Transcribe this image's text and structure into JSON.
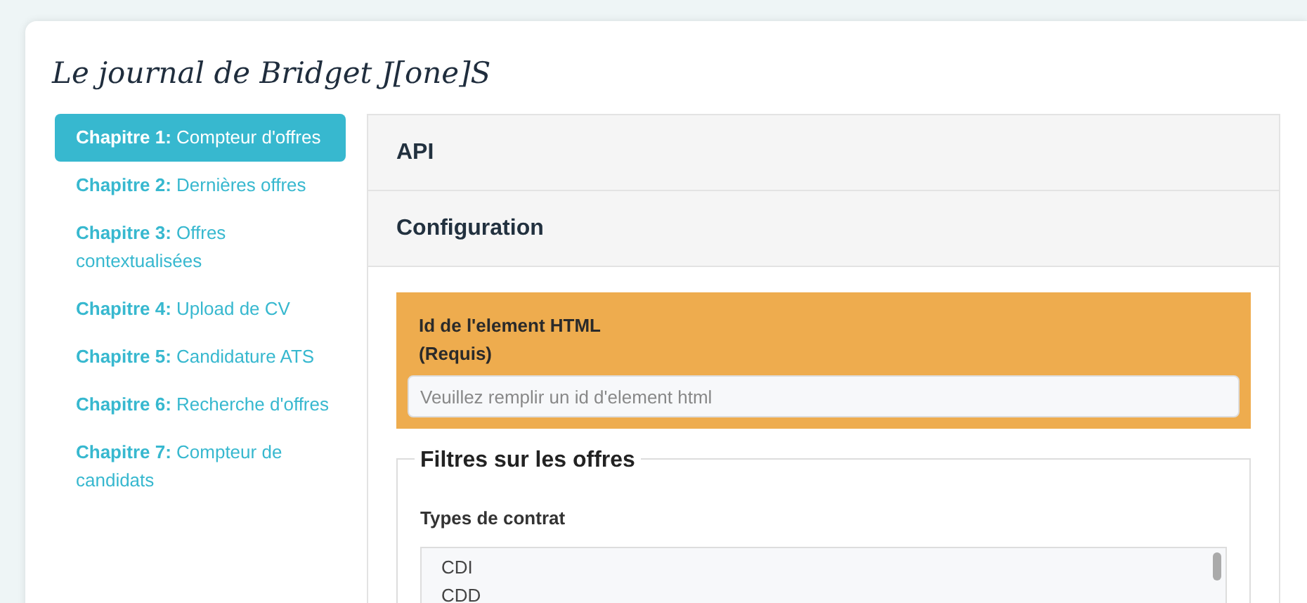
{
  "title": "Le journal de Bridget J[one]S",
  "sidebar": {
    "items": [
      {
        "text": "**Chapitre 1:** Compteur d'offres",
        "selected": true
      },
      {
        "text": "**Chapitre 2:** Dernières offres",
        "selected": false
      },
      {
        "text": "**Chapitre 3:** Offres contextualisées",
        "selected": false
      },
      {
        "text": "**Chapitre 4:** Upload de CV",
        "selected": false
      },
      {
        "text": "**Chapitre 5:** Candidature ATS",
        "selected": false
      },
      {
        "text": "**Chapitre 6:** Recherche d'offres",
        "selected": false
      },
      {
        "text": "**Chapitre 7:** Compteur de candidats",
        "selected": false
      }
    ]
  },
  "panels": [
    {
      "title": "API"
    },
    {
      "title": "Configuration"
    }
  ],
  "required_field": {
    "label": "Id de l'element HTML",
    "note": "(Requis)",
    "placeholder": "Veuillez remplir un id d'element html"
  },
  "fieldset": {
    "legend": "Filtres sur les offres",
    "list_label": "Types de contrat",
    "options": [
      "CDI",
      "CDD"
    ]
  }
}
